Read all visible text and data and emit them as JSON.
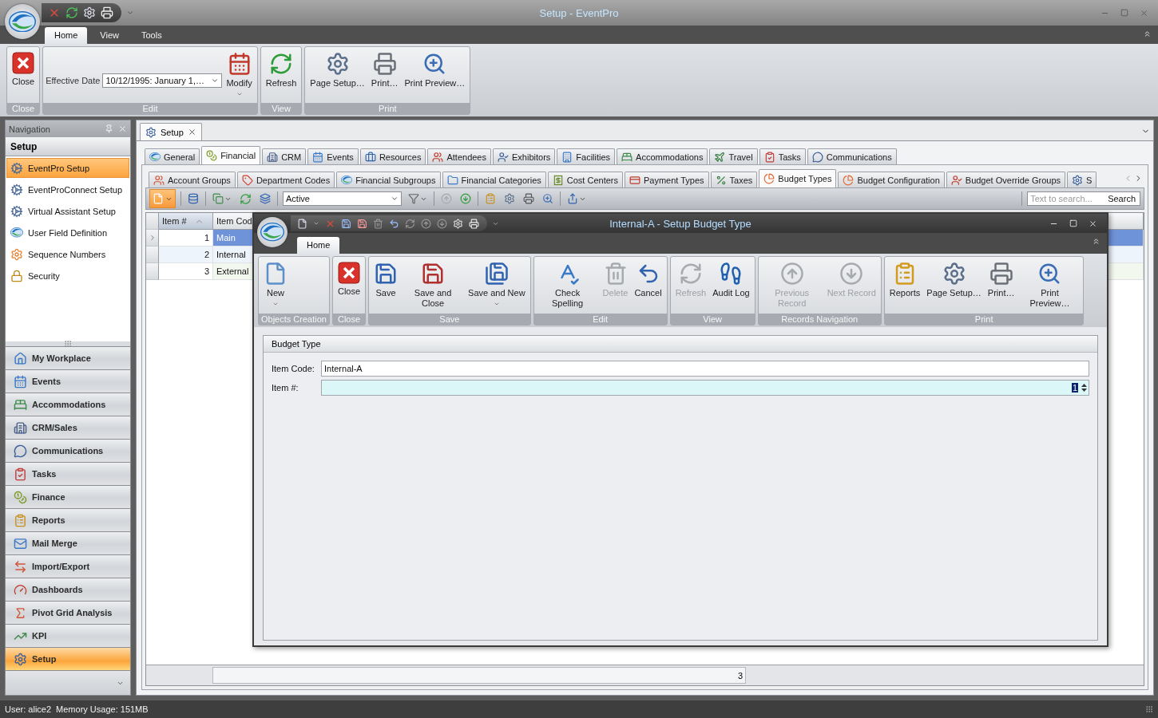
{
  "window": {
    "title": "Setup - EventPro"
  },
  "ribbon": {
    "tabs": [
      {
        "label": "Home",
        "selected": true
      },
      {
        "label": "View",
        "selected": false
      },
      {
        "label": "Tools",
        "selected": false
      }
    ],
    "groups": [
      {
        "label": "Close",
        "items": [
          {
            "kind": "button",
            "label": "Close",
            "disabled": false,
            "has_menu": false
          }
        ]
      },
      {
        "label": "Edit",
        "items": [
          {
            "kind": "combo",
            "label": "Effective Date",
            "value": "10/12/1995: January 1,…"
          },
          {
            "kind": "button",
            "label": "Modify",
            "disabled": false,
            "has_menu": true
          }
        ]
      },
      {
        "label": "View",
        "items": [
          {
            "kind": "button",
            "label": "Refresh",
            "disabled": false,
            "has_menu": false
          }
        ]
      },
      {
        "label": "Print",
        "items": [
          {
            "kind": "button",
            "label": "Page Setup…",
            "disabled": false,
            "has_menu": false
          },
          {
            "kind": "button",
            "label": "Print…",
            "disabled": false,
            "has_menu": false
          },
          {
            "kind": "button",
            "label": "Print Preview…",
            "disabled": false,
            "has_menu": false
          }
        ]
      }
    ]
  },
  "navigation": {
    "title": "Navigation",
    "section": "Setup",
    "items": [
      {
        "label": "EventPro Setup",
        "selected": true
      },
      {
        "label": "EventProConnect Setup",
        "selected": false
      },
      {
        "label": "Virtual Assistant Setup",
        "selected": false
      },
      {
        "label": "User Field Definition",
        "selected": false
      },
      {
        "label": "Sequence Numbers",
        "selected": false
      },
      {
        "label": "Security",
        "selected": false
      }
    ],
    "modules": [
      {
        "label": "My Workplace",
        "selected": false
      },
      {
        "label": "Events",
        "selected": false
      },
      {
        "label": "Accommodations",
        "selected": false
      },
      {
        "label": "CRM/Sales",
        "selected": false
      },
      {
        "label": "Communications",
        "selected": false
      },
      {
        "label": "Tasks",
        "selected": false
      },
      {
        "label": "Finance",
        "selected": false
      },
      {
        "label": "Reports",
        "selected": false
      },
      {
        "label": "Mail Merge",
        "selected": false
      },
      {
        "label": "Import/Export",
        "selected": false
      },
      {
        "label": "Dashboards",
        "selected": false
      },
      {
        "label": "Pivot Grid Analysis",
        "selected": false
      },
      {
        "label": "KPI",
        "selected": false
      },
      {
        "label": "Setup",
        "selected": true
      }
    ]
  },
  "document_tabs": [
    {
      "label": "Setup",
      "selected": true
    }
  ],
  "module_tabs": [
    {
      "label": "General",
      "selected": false
    },
    {
      "label": "Financial",
      "selected": true
    },
    {
      "label": "CRM",
      "selected": false
    },
    {
      "label": "Events",
      "selected": false
    },
    {
      "label": "Resources",
      "selected": false
    },
    {
      "label": "Attendees",
      "selected": false
    },
    {
      "label": "Exhibitors",
      "selected": false
    },
    {
      "label": "Facilities",
      "selected": false
    },
    {
      "label": "Accommodations",
      "selected": false
    },
    {
      "label": "Travel",
      "selected": false
    },
    {
      "label": "Tasks",
      "selected": false
    },
    {
      "label": "Communications",
      "selected": false
    }
  ],
  "sub_tabs": [
    {
      "label": "Account Groups",
      "selected": false
    },
    {
      "label": "Department Codes",
      "selected": false
    },
    {
      "label": "Financial Subgroups",
      "selected": false
    },
    {
      "label": "Financial Categories",
      "selected": false
    },
    {
      "label": "Cost Centers",
      "selected": false
    },
    {
      "label": "Payment Types",
      "selected": false
    },
    {
      "label": "Taxes",
      "selected": false
    },
    {
      "label": "Budget Types",
      "selected": true
    },
    {
      "label": "Budget Configuration",
      "selected": false
    },
    {
      "label": "Budget Override Groups",
      "selected": false
    },
    {
      "label": "S",
      "selected": false
    }
  ],
  "toolbar": {
    "filter": "Active",
    "search": {
      "placeholder": "Text to search...",
      "button": "Search"
    }
  },
  "grid": {
    "columns": [
      {
        "label": "Item #",
        "sorted": true
      },
      {
        "label": "Item Cod",
        "sorted": false
      }
    ],
    "rows": [
      {
        "item_no": "1",
        "item_code": "Main",
        "selected": true
      },
      {
        "item_no": "2",
        "item_code": "Internal",
        "selected": false
      },
      {
        "item_no": "3",
        "item_code": "External",
        "selected": false
      }
    ],
    "footer": {
      "count": "3"
    }
  },
  "dialog": {
    "title": "Internal-A - Setup Budget Type",
    "ribbon": {
      "tabs": [
        {
          "label": "Home",
          "selected": true
        }
      ],
      "groups": [
        {
          "label": "Objects Creation",
          "items": [
            {
              "kind": "button",
              "label": "New",
              "disabled": false,
              "has_menu": true
            }
          ]
        },
        {
          "label": "Close",
          "items": [
            {
              "kind": "button",
              "label": "Close",
              "disabled": false,
              "has_menu": false
            }
          ]
        },
        {
          "label": "Save",
          "items": [
            {
              "kind": "button",
              "label": "Save",
              "disabled": false,
              "has_menu": false
            },
            {
              "kind": "button",
              "label": "Save and Close",
              "disabled": false,
              "has_menu": false
            },
            {
              "kind": "button",
              "label": "Save and New",
              "disabled": false,
              "has_menu": true
            }
          ]
        },
        {
          "label": "Edit",
          "items": [
            {
              "kind": "button",
              "label": "Check Spelling",
              "disabled": false,
              "has_menu": false
            },
            {
              "kind": "button",
              "label": "Delete",
              "disabled": true,
              "has_menu": false
            },
            {
              "kind": "button",
              "label": "Cancel",
              "disabled": false,
              "has_menu": false
            }
          ]
        },
        {
          "label": "View",
          "items": [
            {
              "kind": "button",
              "label": "Refresh",
              "disabled": true,
              "has_menu": false
            },
            {
              "kind": "button",
              "label": "Audit Log",
              "disabled": false,
              "has_menu": false
            }
          ]
        },
        {
          "label": "Records Navigation",
          "items": [
            {
              "kind": "button",
              "label": "Previous Record",
              "disabled": true,
              "has_menu": false
            },
            {
              "kind": "button",
              "label": "Next Record",
              "disabled": true,
              "has_menu": false
            }
          ]
        },
        {
          "label": "Print",
          "items": [
            {
              "kind": "button",
              "label": "Reports",
              "disabled": false,
              "has_menu": false
            },
            {
              "kind": "button",
              "label": "Page Setup…",
              "disabled": false,
              "has_menu": false
            },
            {
              "kind": "button",
              "label": "Print…",
              "disabled": false,
              "has_menu": false
            },
            {
              "kind": "button",
              "label": "Print Preview…",
              "disabled": false,
              "has_menu": false
            }
          ]
        }
      ]
    },
    "form": {
      "title": "Budget Type",
      "fields": [
        {
          "kind": "text",
          "label": "Item Code:",
          "value": "Internal-A",
          "focused": false
        },
        {
          "kind": "spin",
          "label": "Item #:",
          "value": "1",
          "focused": true
        }
      ]
    }
  },
  "status_bar": {
    "user": "User: alice2",
    "memory": "Memory Usage: 151MB"
  }
}
